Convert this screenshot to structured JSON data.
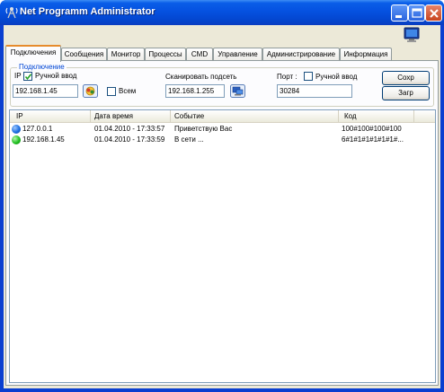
{
  "window": {
    "title": "Net Programm Administrator",
    "accent": "#0a3fd0",
    "icons": {
      "app": "antenna-app-icon",
      "minimize": "minimize-icon",
      "maximize": "maximize-icon",
      "close": "close-icon",
      "tray": "monitor-icon"
    }
  },
  "tabs": [
    {
      "label": "Подключения",
      "active": true
    },
    {
      "label": "Сообщения"
    },
    {
      "label": "Монитор"
    },
    {
      "label": "Процессы"
    },
    {
      "label": "CMD"
    },
    {
      "label": "Управление"
    },
    {
      "label": "Администрирование"
    },
    {
      "label": "Информация"
    }
  ],
  "connection": {
    "group_label": "Подключение",
    "ip_label": "IP",
    "manual_label": "Ручной ввод",
    "manual_checked": true,
    "ip_value": "192.168.1.45",
    "all_label": "Всем",
    "all_checked": false,
    "scan_label": "Сканировать подсеть",
    "scan_value": "192.168.1.255",
    "port_label": "Порт :",
    "port_manual_label": "Ручной ввод",
    "port_manual_checked": false,
    "port_value": "30284",
    "save_button": "Сохр",
    "load_button": "Загр"
  },
  "table": {
    "columns": [
      "IP",
      "Дата время",
      "Событие",
      "Код"
    ],
    "rows": [
      {
        "ip": "127.0.0.1",
        "datetime": "01.04.2010 - 17:33:57",
        "event": "Приветствую Вас",
        "code": "100#100#100#100",
        "status_color": "#1d6fe0"
      },
      {
        "ip": "192.168.1.45",
        "datetime": "01.04.2010 - 17:33:59",
        "event": "В сети ...",
        "code": "6#1#1#1#1#1#1#...",
        "status_color": "#21c021"
      }
    ]
  }
}
